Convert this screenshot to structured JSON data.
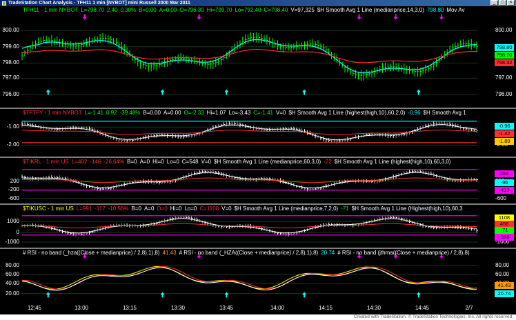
{
  "window": {
    "title": "TradeStation Chart Analysis - TFH11 1 min [NYBOT] mini Russell 2000 Mar 2011",
    "minimize": "_",
    "maximize": "□",
    "close": "×"
  },
  "panes": [
    {
      "id": "price",
      "header": [
        {
          "text": "TFH11 - 1 min  NYBOT",
          "color": "#00ff00"
        },
        {
          "text": "L=798.70",
          "color": "#00ff00"
        },
        {
          "text": "2.40",
          "color": "#00ff00"
        },
        {
          "text": "0.30%",
          "color": "#00ff00"
        },
        {
          "text": "B=0.00",
          "color": "#00ff00"
        },
        {
          "text": "A=0.00",
          "color": "#00ff00"
        },
        {
          "text": "O=796.30",
          "color": "#00ff00"
        },
        {
          "text": "Hi=799.70",
          "color": "#00ff00"
        },
        {
          "text": "Lo=792.40",
          "color": "#00ff00"
        },
        {
          "text": "C=798.40",
          "color": "#00ff00"
        },
        {
          "text": "V=97,325",
          "color": "#ffffff"
        },
        {
          "text": "$H Smooth Avg 1 Line (medianprice,14,3,0)",
          "color": "#ffffff"
        },
        {
          "text": "798.80",
          "color": "#00ffff"
        },
        {
          "text": "Mov Av",
          "color": "#ffffff"
        }
      ],
      "left_ticks": [
        "800.00",
        "799.00",
        "798.00",
        "797.00",
        "796.00"
      ],
      "right_ticks": [
        "800.00",
        "799.00",
        "798.00",
        "797.00",
        "796.00"
      ],
      "tags": [
        {
          "text": "798.80",
          "bg": "#00ffff"
        },
        {
          "text": "798.70",
          "bg": "#00ff00"
        },
        {
          "text": "798.32",
          "bg": "#ff3030"
        }
      ]
    },
    {
      "id": "tftfy",
      "header": [
        {
          "text": "$TFTFY - 1 min  NYBOT",
          "color": "#ff3030"
        },
        {
          "text": "L=-1.41",
          "color": "#00ff00"
        },
        {
          "text": "0.92",
          "color": "#00ff00"
        },
        {
          "text": "-39.48%",
          "color": "#00ff00"
        },
        {
          "text": "B=0.00",
          "color": "#ffffff"
        },
        {
          "text": "A=0.00",
          "color": "#ffffff"
        },
        {
          "text": "O=-2.33",
          "color": "#00ff00"
        },
        {
          "text": "Hi=1.07",
          "color": "#ffffff"
        },
        {
          "text": "Lo=-3.43",
          "color": "#ffffff"
        },
        {
          "text": "C=-1.41",
          "color": "#00ff00"
        },
        {
          "text": "V=0",
          "color": "#ffffff"
        },
        {
          "text": "$H Smooth Avg 1 Line (highest(high,10),60,2,0)",
          "color": "#ffffff"
        },
        {
          "text": "-0.96",
          "color": "#00ffff"
        },
        {
          "text": "$H Smooth Avg 1",
          "color": "#ffffff"
        }
      ],
      "left_ticks": [
        "-1.00",
        "-2.00"
      ],
      "right_ticks": [
        "-1.00",
        "-2.00"
      ],
      "tags": [
        {
          "text": "-0.96",
          "bg": "#00ffff"
        },
        {
          "text": "-1.42",
          "bg": "#ff3030"
        },
        {
          "text": "-1.89",
          "bg": "#ffcc00"
        }
      ]
    },
    {
      "id": "tikrl",
      "header": [
        {
          "text": "$TIKRL - 1 min  US",
          "color": "#ff3030"
        },
        {
          "text": "L=402",
          "color": "#ff3030"
        },
        {
          "text": "-146",
          "color": "#ff3030"
        },
        {
          "text": "-26.64%",
          "color": "#ff3030"
        },
        {
          "text": "B=0",
          "color": "#ffffff"
        },
        {
          "text": "A=0",
          "color": "#ffffff"
        },
        {
          "text": "Hi=0",
          "color": "#ffffff"
        },
        {
          "text": "Lo=0",
          "color": "#ffffff"
        },
        {
          "text": "C=548",
          "color": "#ffffff"
        },
        {
          "text": "V=0",
          "color": "#ffffff"
        },
        {
          "text": "$H Smooth Avg 1 Line (medianprice,60,3,0)",
          "color": "#ffffff"
        },
        {
          "text": "-22",
          "color": "#ff3030"
        },
        {
          "text": "$H Smooth Avg 1 Line (highest(high,10),60,3,0)",
          "color": "#ffffff"
        }
      ],
      "left_ticks": [
        "200",
        "-200",
        "-600"
      ],
      "right_ticks": [
        "200",
        "-200",
        "-600"
      ],
      "tags": [
        {
          "text": "284",
          "bg": "#ff00ff"
        },
        {
          "text": "-96",
          "bg": "#00ffff"
        },
        {
          "text": "-412",
          "bg": "#ff00ff"
        }
      ]
    },
    {
      "id": "tikusc",
      "header": [
        {
          "text": "$TIKUSC - 1 min  US",
          "color": "#ffff00"
        },
        {
          "text": "L=991",
          "color": "#ff3030"
        },
        {
          "text": "-117",
          "color": "#ff3030"
        },
        {
          "text": "-10.56%",
          "color": "#ff3030"
        },
        {
          "text": "B=0",
          "color": "#ffffff"
        },
        {
          "text": "A=0",
          "color": "#ffffff"
        },
        {
          "text": "O=0",
          "color": "#ff3030"
        },
        {
          "text": "Hi=0",
          "color": "#ffffff"
        },
        {
          "text": "Lo=0",
          "color": "#ffffff"
        },
        {
          "text": "C=1108",
          "color": "#ff3030"
        },
        {
          "text": "V=0",
          "color": "#ffffff"
        },
        {
          "text": "$H Smooth Avg 1 Line (medianprice,7,2,0)",
          "color": "#ffffff"
        },
        {
          "text": "-71",
          "color": "#00ff00"
        },
        {
          "text": "$H Smooth Avg 1 Line (Highest(high,10),60,3",
          "color": "#ffffff"
        }
      ],
      "left_ticks": [
        "1000",
        "0",
        "-1000"
      ],
      "right_ticks": [
        "1000",
        "0",
        "-1000"
      ],
      "tags": [
        {
          "text": "1108",
          "bg": "#ffff00"
        },
        {
          "text": "456",
          "bg": "#ff3030"
        },
        {
          "text": "-71",
          "bg": "#00ff00"
        },
        {
          "text": "-588",
          "bg": "#ff00ff"
        }
      ]
    },
    {
      "id": "rsi",
      "header": [
        {
          "text": "# RSI - no band (_hza((Close + medianprice) / 2,8),1),8)",
          "color": "#ffffff"
        },
        {
          "text": "41.43",
          "color": "#ff9900"
        },
        {
          "text": "# RSI - no band (_HZA((Close + medianprice) / 2,8),1),8)",
          "color": "#ffffff"
        },
        {
          "text": "20.74",
          "color": "#00ffff"
        },
        {
          "text": "# RSI - no band (jthma((Close + medianprice) / 2,8),8)",
          "color": "#ffffff"
        }
      ],
      "left_ticks": [
        "80.00",
        "60.00",
        "40.00",
        "20.00"
      ],
      "right_ticks": [
        "80.00",
        "60.00",
        "40.00",
        "20.00"
      ],
      "tags": [
        {
          "text": "41.43",
          "bg": "#ff9900"
        },
        {
          "text": "20.74",
          "bg": "#00ffff"
        }
      ]
    }
  ],
  "xaxis": {
    "labels": [
      "12:45",
      "13:00",
      "13:15",
      "13:30",
      "13:45",
      "14:00",
      "14:15",
      "14:30",
      "14:45",
      "2/7"
    ]
  },
  "footer": "Created with TradeStation. © TradeStation Technologies, Inc. All rights reserved.",
  "colors": {
    "background": "#000000",
    "bars": "#00ff00",
    "smooth_line": "#00ffff",
    "avg_line": "#ff3030",
    "buy_arrow": "#00ffff",
    "sell_arrow": "#ff00ff"
  }
}
